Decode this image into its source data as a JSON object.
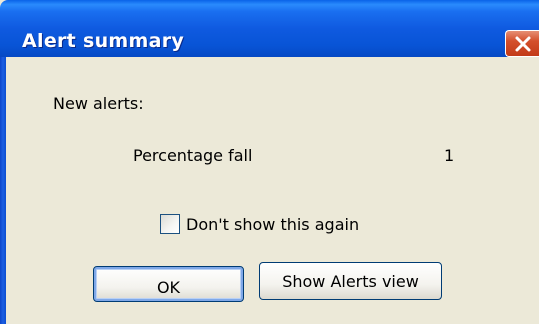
{
  "window": {
    "title": "Alert summary",
    "close_icon": "close-icon",
    "accent_color": "#0a5ae0",
    "close_color": "#c8451f"
  },
  "content": {
    "heading": "New alerts:",
    "alerts": [
      {
        "name": "Percentage fall",
        "count": "1"
      }
    ],
    "checkbox": {
      "label": "Don't show this again",
      "checked": false
    }
  },
  "buttons": {
    "ok_label": "OK",
    "show_alerts_label": "Show Alerts view"
  }
}
